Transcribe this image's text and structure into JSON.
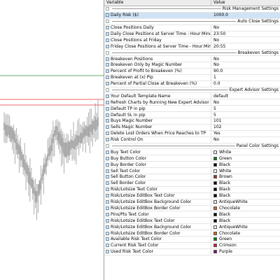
{
  "header": {
    "variable": "Variable",
    "value": "Value"
  },
  "rows": [
    {
      "type": "section",
      "title": "Risk Management Settings"
    },
    {
      "type": "param",
      "name": "Daily Risk ($)",
      "value": "1000.0"
    },
    {
      "type": "section",
      "title": "Auto Close Settings"
    },
    {
      "type": "param",
      "name": "Close Positions Daily",
      "value": "No"
    },
    {
      "type": "param",
      "name": "Daily Close Positions at Server Time - Hour:Minute",
      "value": "23:50"
    },
    {
      "type": "param",
      "name": "Close Positions at Friday",
      "value": "No"
    },
    {
      "type": "param",
      "name": "Friday Close Positions at Server Time - Hour:Minute",
      "value": "20:55"
    },
    {
      "type": "section",
      "title": "Breakeven Settings"
    },
    {
      "type": "param",
      "name": "Breakeven Positions",
      "value": "No"
    },
    {
      "type": "param",
      "name": "Breakeven Only by Magic Number",
      "value": "No"
    },
    {
      "type": "param",
      "name": "Percent of Profit to Breakeven (%)",
      "value": "90.0"
    },
    {
      "type": "param",
      "name": "Breakeven at (x) Pip",
      "value": "1"
    },
    {
      "type": "param",
      "name": "Percent of Partial Close at Breakeven (%)",
      "value": "0.0"
    },
    {
      "type": "section",
      "title": "Expert Advisor Settings"
    },
    {
      "type": "param",
      "name": "Your Default Template Name",
      "value": "default"
    },
    {
      "type": "param",
      "name": "Refresh Charts by Running New Expert Advisor",
      "value": "No"
    },
    {
      "type": "param",
      "name": "Default TP in pip",
      "value": "5"
    },
    {
      "type": "param",
      "name": "Default SL in pip",
      "value": "5"
    },
    {
      "type": "param",
      "name": "Buys Magic Number",
      "value": "101"
    },
    {
      "type": "param",
      "name": "Sells Magic Number",
      "value": "102"
    },
    {
      "type": "param",
      "name": "Delete Lost Orders When Price Reaches to TP",
      "value": "Yes"
    },
    {
      "type": "param",
      "name": "Risk Control On",
      "value": "No"
    },
    {
      "type": "section",
      "title": "Panel Color Settings"
    },
    {
      "type": "param",
      "name": "Buy Text Color",
      "value": "White",
      "color": "#ffffff"
    },
    {
      "type": "param",
      "name": "Buy Button Color",
      "value": "Green",
      "color": "#008000"
    },
    {
      "type": "param",
      "name": "Buy Border Color",
      "value": "Black",
      "color": "#000000"
    },
    {
      "type": "param",
      "name": "Sell Text Color",
      "value": "White",
      "color": "#ffffff"
    },
    {
      "type": "param",
      "name": "Sell Button Color",
      "value": "Brown",
      "color": "#a52a2a"
    },
    {
      "type": "param",
      "name": "Sell Border Color",
      "value": "Black",
      "color": "#000000"
    },
    {
      "type": "param",
      "name": "Risk/Lotsize Text Color",
      "value": "Black",
      "color": "#000000"
    },
    {
      "type": "param",
      "name": "Risk/Lotsize EditBox Text Color",
      "value": "Black",
      "color": "#000000"
    },
    {
      "type": "param",
      "name": "Risk/Lotsize EditBox Background Color",
      "value": "AntiqueWhite",
      "color": "#faebd7"
    },
    {
      "type": "param",
      "name": "Risk/Lotsize EditBox Border Color",
      "value": "Chocolate",
      "color": "#d2691e"
    },
    {
      "type": "param",
      "name": "Pins/Pts Text Color",
      "value": "Black",
      "color": "#000000"
    },
    {
      "type": "param",
      "name": "Risk/Lotsize EditBox Text Color",
      "value": "Black",
      "color": "#000000"
    },
    {
      "type": "param",
      "name": "Risk/Lotsize EditBox Background Color",
      "value": "AntiqueWhite",
      "color": "#faebd7"
    },
    {
      "type": "param",
      "name": "Risk/Lotsize EditBox Border Color",
      "value": "Chocolate",
      "color": "#d2691e"
    },
    {
      "type": "param",
      "name": "Available Risk Text Color",
      "value": "Green",
      "color": "#008000"
    },
    {
      "type": "param",
      "name": "Current Risk Text Color",
      "value": "Crimson",
      "color": "#dc143c"
    },
    {
      "type": "param",
      "name": "Used Risk Text Color",
      "value": "Purple",
      "color": "#800080"
    }
  ],
  "chart": {
    "colors": {
      "candle": "#9a9a9a",
      "level_green": "#2e8b3a",
      "level_red": "#e03030",
      "grid": "#d0d0d0"
    },
    "levels": [
      {
        "color": "green",
        "price_rank": 0.27
      },
      {
        "color": "red",
        "price_rank": 0.355
      },
      {
        "color": "red",
        "price_rank": 0.375
      }
    ]
  }
}
